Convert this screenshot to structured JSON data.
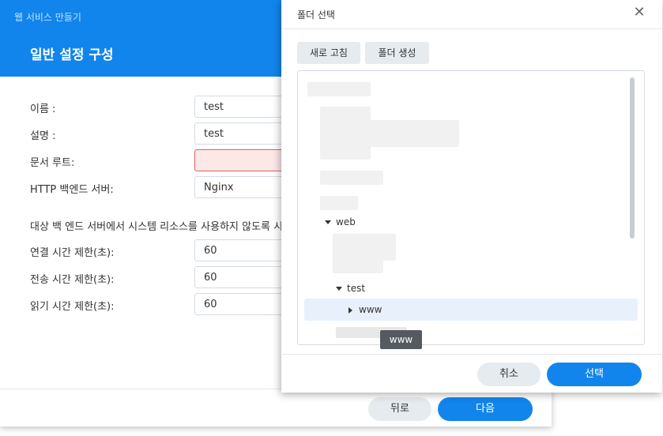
{
  "wizard": {
    "app_title": "웹 서비스 만들기",
    "step_title": "일반 설정 구성",
    "fields": [
      {
        "label": "이름 :",
        "value": "test"
      },
      {
        "label": "설명 :",
        "value": "test"
      },
      {
        "label": "문서 루트:",
        "value": ""
      },
      {
        "label": "HTTP 백엔드 서버:",
        "value": "Nginx"
      }
    ],
    "note": "대상 백 엔드 서버에서 시스템 리소스를 사용하지 않도록 시",
    "timeouts": [
      {
        "label": "연결 시간 제한(초):",
        "value": "60"
      },
      {
        "label": "전송 시간 제한(초):",
        "value": "60"
      },
      {
        "label": "읽기 시간 제한(초):",
        "value": "60"
      }
    ],
    "back_label": "뒤로",
    "next_label": "다음"
  },
  "dialog": {
    "title": "폴더 선택",
    "close_glyph": "✕",
    "refresh_label": "새로 고침",
    "create_folder_label": "폴더 생성",
    "tree": {
      "web": "web",
      "test": "test",
      "www": "www"
    },
    "tooltip": "www",
    "cancel_label": "취소",
    "select_label": "선택"
  },
  "colors": {
    "accent": "#1185ec",
    "selected_row": "#e8f1fb"
  }
}
